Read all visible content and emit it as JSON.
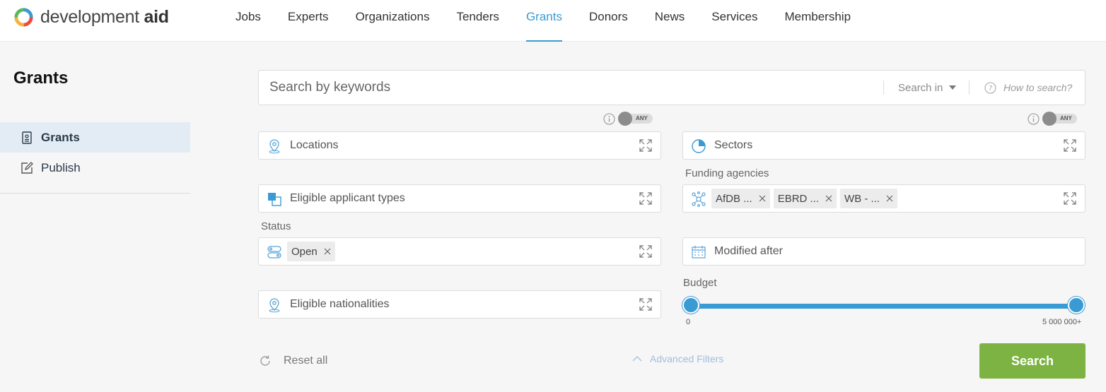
{
  "header": {
    "logo": {
      "prefix": "development",
      "suffix": "aid"
    },
    "nav": [
      {
        "label": "Jobs",
        "active": false
      },
      {
        "label": "Experts",
        "active": false
      },
      {
        "label": "Organizations",
        "active": false
      },
      {
        "label": "Tenders",
        "active": false
      },
      {
        "label": "Grants",
        "active": true
      },
      {
        "label": "Donors",
        "active": false
      },
      {
        "label": "News",
        "active": false
      },
      {
        "label": "Services",
        "active": false
      },
      {
        "label": "Membership",
        "active": false
      }
    ]
  },
  "sidebar": {
    "title": "Grants",
    "items": [
      {
        "label": "Grants",
        "icon": "document-icon",
        "active": true
      },
      {
        "label": "Publish",
        "icon": "edit-icon",
        "active": false
      }
    ]
  },
  "search": {
    "placeholder": "Search by keywords",
    "search_in": "Search in",
    "how_to": "How to search?"
  },
  "toggles": {
    "locations": "ANY",
    "sectors": "ANY"
  },
  "filters": {
    "locations": "Locations",
    "sectors": "Sectors",
    "funding_agencies_label": "Funding agencies",
    "funding_agencies": [
      "AfDB ...",
      "EBRD ...",
      "WB - ..."
    ],
    "eligible_applicant_types": "Eligible applicant types",
    "status_label": "Status",
    "status": [
      "Open"
    ],
    "modified_after": "Modified after",
    "eligible_nationalities": "Eligible nationalities",
    "budget": {
      "label": "Budget",
      "min": "0",
      "max": "5 000 000+"
    }
  },
  "actions": {
    "reset": "Reset all",
    "advanced": "Advanced Filters",
    "search": "Search"
  },
  "colors": {
    "accent": "#3a9bd4",
    "search_button": "#7cb342",
    "sidebar_active": "#e3ecf4"
  }
}
